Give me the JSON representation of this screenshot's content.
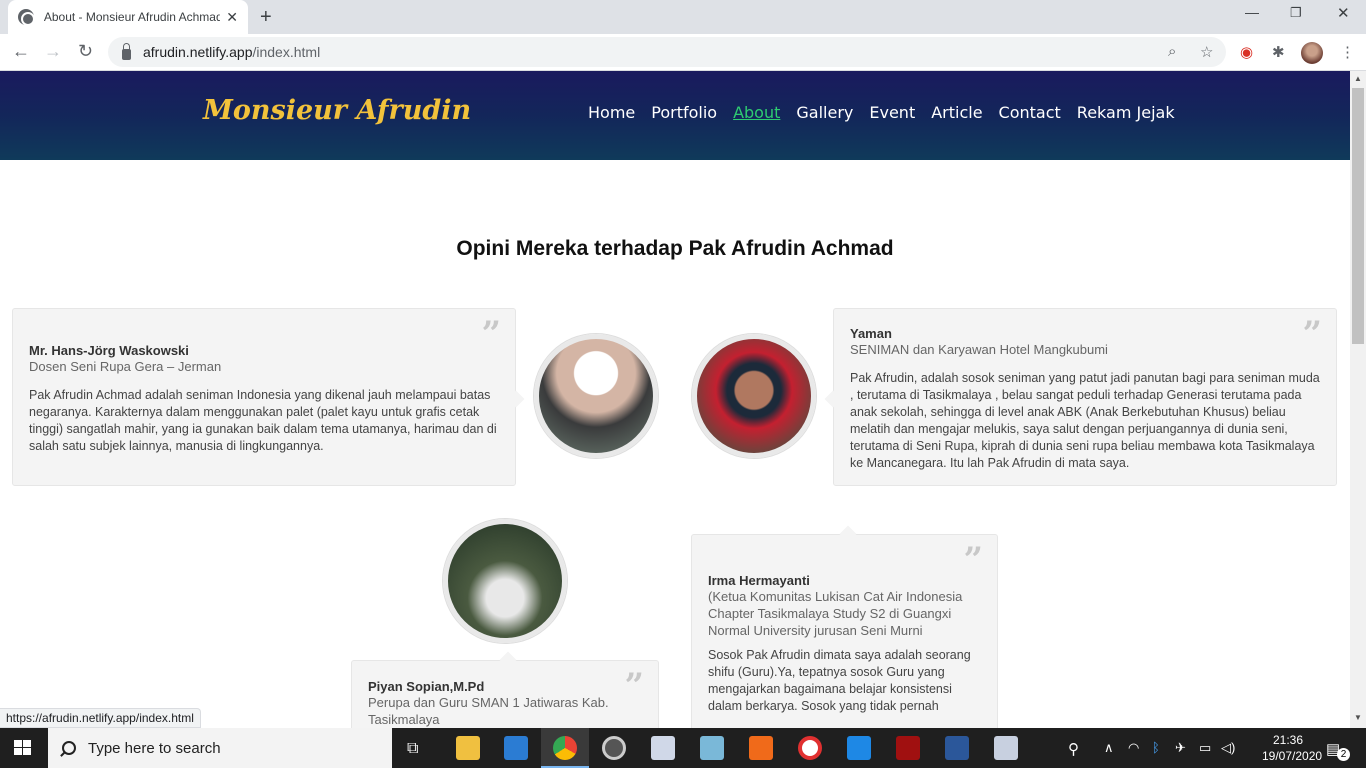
{
  "browser": {
    "tab_title": "About - Monsieur Afrudin Achmad",
    "url_host": "afrudin.netlify.app",
    "url_path": "/index.html",
    "status_url": "https://afrudin.netlify.app/index.html"
  },
  "site": {
    "brand": "Monsieur Afrudin",
    "nav": [
      "Home",
      "Portfolio",
      "About",
      "Gallery",
      "Event",
      "Article",
      "Contact",
      "Rekam Jejak"
    ],
    "active_nav": "About",
    "heading": "Opini Mereka terhadap Pak Afrudin Achmad"
  },
  "testimonials": [
    {
      "name": "Mr. Hans-Jörg Waskowski",
      "role": "Dosen Seni Rupa Gera – Jerman",
      "text": "Pak Afrudin Achmad adalah seniman Indonesia yang dikenal jauh melampaui batas negaranya. Karakternya dalam menggunakan palet (palet kayu untuk grafis cetak tinggi) sangatlah mahir, yang ia gunakan baik dalam tema utamanya, harimau dan di salah satu subjek lainnya, manusia di lingkungannya."
    },
    {
      "name": "Yaman",
      "role": "SENIMAN dan Karyawan Hotel Mangkubumi",
      "text": "Pak Afrudin, adalah sosok seniman yang patut jadi panutan bagi para seniman muda , terutama di Tasikmalaya , belau sangat peduli terhadap Generasi terutama pada anak sekolah, sehingga di level anak ABK (Anak Berkebutuhan Khusus) beliau melatih dan mengajar melukis, saya salut dengan perjuangannya di dunia seni, terutama di Seni Rupa, kiprah di dunia seni rupa beliau membawa kota Tasikmalaya ke Mancanegara. Itu lah Pak Afrudin di mata saya."
    },
    {
      "name": "Piyan Sopian,M.Pd",
      "role": "Perupa dan Guru SMAN 1 Jatiwaras Kab. Tasikmalaya",
      "text": ""
    },
    {
      "name": "Irma Hermayanti",
      "role": "(Ketua Komunitas Lukisan Cat Air Indonesia Chapter Tasikmalaya Study S2 di Guangxi Normal University jurusan Seni Murni",
      "text": "Sosok Pak Afrudin dimata saya adalah seorang shifu (Guru).Ya, tepatnya sosok Guru yang mengajarkan bagaimana belajar konsistensi dalam berkarya. Sosok yang tidak pernah"
    }
  ],
  "taskbar": {
    "search_placeholder": "Type here to search",
    "time": "21:36",
    "date": "19/07/2020",
    "notifications": "2"
  }
}
